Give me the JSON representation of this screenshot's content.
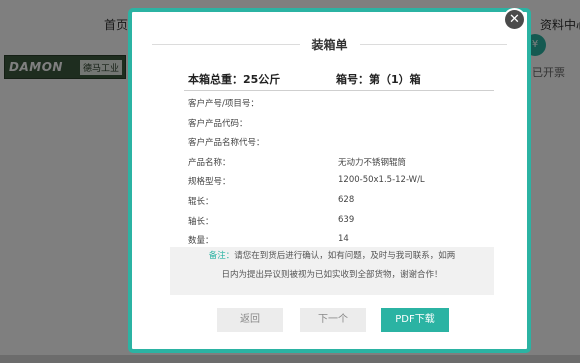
{
  "background": {
    "nav_home": "首页",
    "nav_resource": "资料中心",
    "logo_brand": "DAMON",
    "logo_cn": "德马工业",
    "circle_badge": "¥",
    "invoice_label": "已开票"
  },
  "modal": {
    "title": "装箱单",
    "total_weight": "本箱总重：25公斤",
    "box_number": "箱号：第（1）箱",
    "rows": [
      {
        "label": "客户产号/项目号：",
        "value": ""
      },
      {
        "label": "客户产品代码：",
        "value": ""
      },
      {
        "label": "客户产品名称代号：",
        "value": ""
      },
      {
        "label": "产品名称：",
        "value": "无动力不锈钢辊筒"
      },
      {
        "label": "规格型号：",
        "value": "1200-50x1.5-12-W/L"
      },
      {
        "label": "辊长：",
        "value": "628"
      },
      {
        "label": "轴长：",
        "value": "639"
      },
      {
        "label": "数量：",
        "value": "14"
      }
    ],
    "notice_prefix": "备注：",
    "notice_line1": "请您在到货后进行确认，如有问题，及时与我司联系，如两",
    "notice_line2": "日内为提出异议则被视为已如实收到全部货物，谢谢合作！",
    "buttons": {
      "back": "返回",
      "next": "下一个",
      "pdf": "PDF下载"
    },
    "close_icon": "close-icon"
  },
  "colors": {
    "accent": "#2bb3a3",
    "overlay": "rgba(0,0,0,0.5)"
  }
}
